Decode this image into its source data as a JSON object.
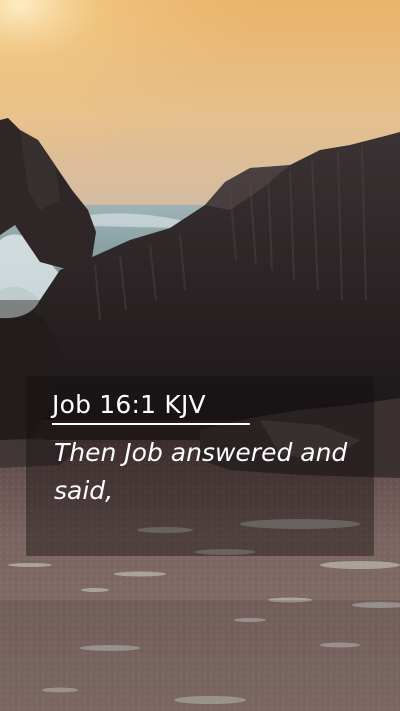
{
  "verse": {
    "reference": "Job 16:1 KJV",
    "text": "Then Job answered and said,"
  },
  "colors": {
    "text": "#ffffff",
    "sky_top": "#e9b56c",
    "sky_bottom": "#cbb8a6",
    "rock": "#2b2424",
    "sand": "#7a6560"
  }
}
